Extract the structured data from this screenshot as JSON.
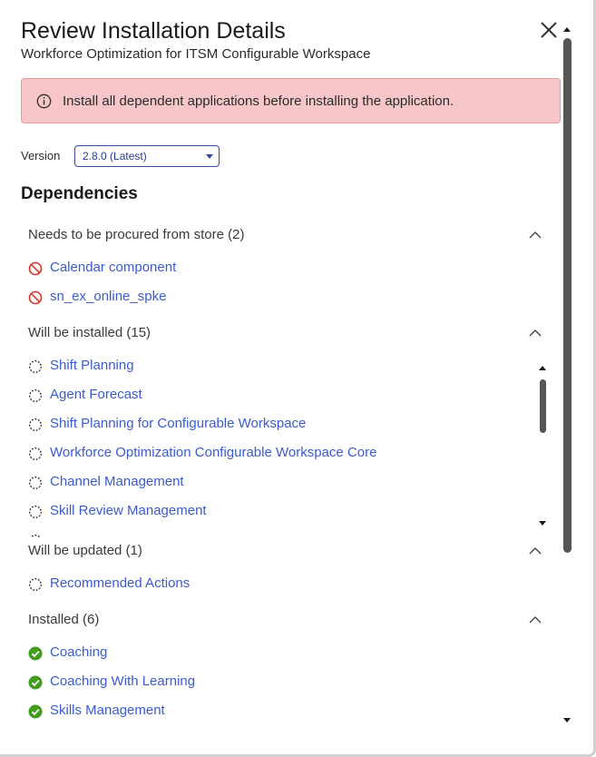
{
  "dialog": {
    "title": "Review Installation Details",
    "subtitle": "Workforce Optimization for ITSM Configurable Workspace",
    "close_icon": "close-icon"
  },
  "alert": {
    "icon": "info-icon",
    "text": "Install all dependent applications before installing the application."
  },
  "version": {
    "label": "Version",
    "selected": "2.8.0 (Latest)"
  },
  "dependencies": {
    "title": "Dependencies",
    "sections": [
      {
        "label": "Needs to be procured from store (2)",
        "expanded": true,
        "items": [
          {
            "label": "Calendar component",
            "icon": "blocked-icon"
          },
          {
            "label": "sn_ex_online_spke",
            "icon": "blocked-icon"
          }
        ]
      },
      {
        "label": "Will be installed (15)",
        "expanded": true,
        "items": [
          {
            "label": "Shift Planning",
            "icon": "pending-icon"
          },
          {
            "label": "Agent Forecast",
            "icon": "pending-icon"
          },
          {
            "label": "Shift Planning for Configurable Workspace",
            "icon": "pending-icon"
          },
          {
            "label": "Workforce Optimization Configurable Workspace Core",
            "icon": "pending-icon"
          },
          {
            "label": "Channel Management",
            "icon": "pending-icon"
          },
          {
            "label": "Skill Review Management",
            "icon": "pending-icon"
          }
        ]
      },
      {
        "label": "Will be updated (1)",
        "expanded": true,
        "items": [
          {
            "label": "Recommended Actions",
            "icon": "pending-icon"
          }
        ]
      },
      {
        "label": "Installed (6)",
        "expanded": true,
        "items": [
          {
            "label": "Coaching",
            "icon": "check-circle-icon"
          },
          {
            "label": "Coaching With Learning",
            "icon": "check-circle-icon"
          },
          {
            "label": "Skills Management",
            "icon": "check-circle-icon"
          }
        ]
      }
    ]
  },
  "colors": {
    "link": "#3b5bd0",
    "alert_bg": "#f6c6c9",
    "alert_border": "#e59aa0",
    "blocked": "#d9342b",
    "installed": "#3f9c1c",
    "select_border": "#3a4aa8"
  }
}
